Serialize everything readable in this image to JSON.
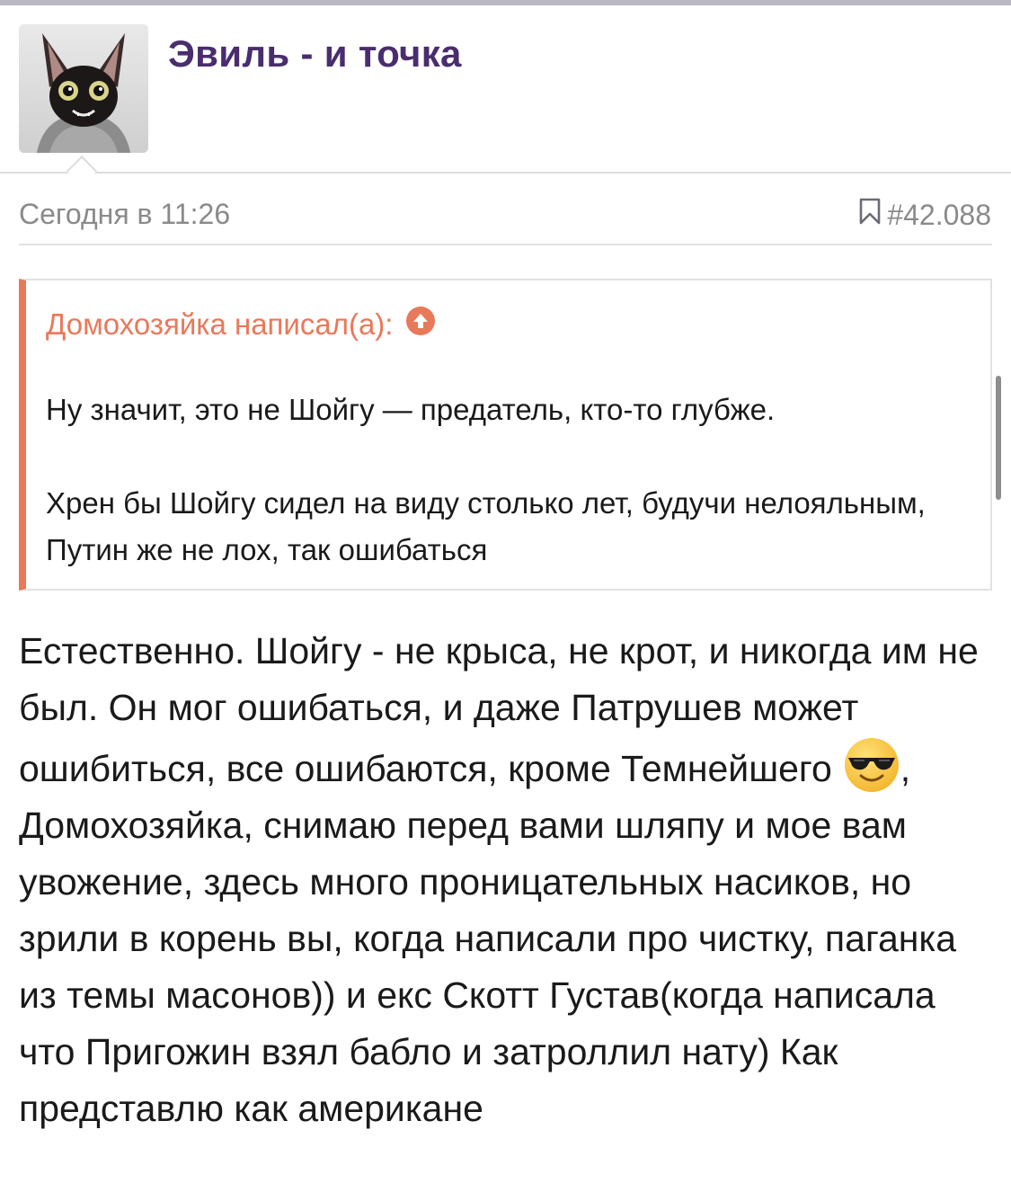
{
  "post": {
    "author": "Эвиль - и точка",
    "date": "Сегодня в 11:26",
    "number": "#42.088",
    "bookmark_icon": "bookmark-icon"
  },
  "quote": {
    "header": "Домохозяйка написал(а):",
    "jump_icon": "arrow-up-circle-icon",
    "accent_color": "#e8795a",
    "paragraphs": [
      "Ну значит, это не Шойгу — предатель, кто-то глубже.",
      "Хрен бы Шойгу сидел на виду столько лет, будучи нелояльным, Путин же не лох, так ошибаться"
    ]
  },
  "message": {
    "part1": "Естественно. Шойгу - не крыса, не крот, и никогда им не был. Он мог ошибаться, и даже Патрушев может ошибиться, все ошибаются, кроме Темнейшего",
    "emoji": "smiling-face-with-sunglasses-emoji",
    "part1_tail": ",",
    "part2": "Домохозяйка, снимаю перед вами шляпу и мое вам увожение, здесь много проницательных насиков, но зрили в корень вы, когда написали про чистку, паганка из темы масонов)) и екс Скотт Густав(когда написала что Пригожин взял бабло и затроллил нату) Как представлю как американе"
  },
  "colors": {
    "author": "#4a2d6e",
    "meta": "#8a8a8a",
    "text": "#1a1a1a"
  }
}
